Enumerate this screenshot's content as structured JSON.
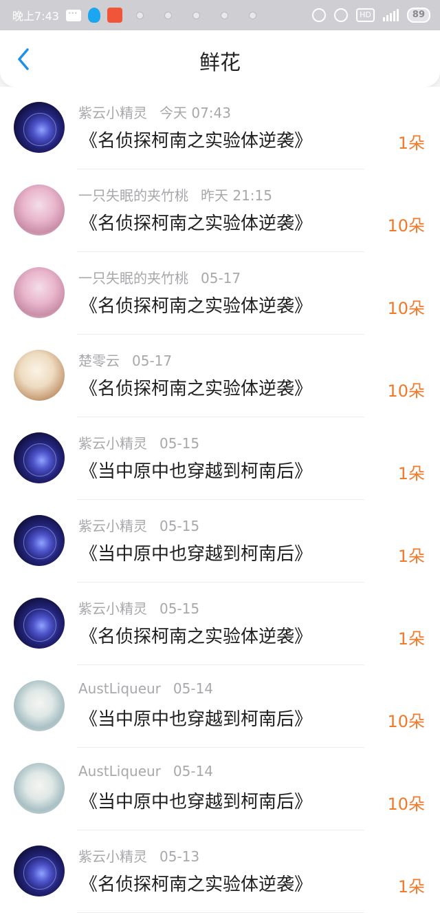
{
  "status_bar": {
    "time": "晚上7:43",
    "hd": "HD",
    "battery": "89"
  },
  "nav": {
    "title": "鲜花"
  },
  "records": [
    {
      "user": "紫云小精灵",
      "time": "今天 07:43",
      "book": "《名侦探柯南之实验体逆袭》",
      "amount": "1朵",
      "avatar": "space"
    },
    {
      "user": "一只失眠的夹竹桃",
      "time": "昨天 21:15",
      "book": "《名侦探柯南之实验体逆袭》",
      "amount": "10朵",
      "avatar": "pink"
    },
    {
      "user": "一只失眠的夹竹桃",
      "time": "05-17",
      "book": "《名侦探柯南之实验体逆袭》",
      "amount": "10朵",
      "avatar": "pink"
    },
    {
      "user": "楚零云",
      "time": "05-17",
      "book": "《名侦探柯南之实验体逆袭》",
      "amount": "10朵",
      "avatar": "blonde"
    },
    {
      "user": "紫云小精灵",
      "time": "05-15",
      "book": "《当中原中也穿越到柯南后》",
      "amount": "1朵",
      "avatar": "space"
    },
    {
      "user": "紫云小精灵",
      "time": "05-15",
      "book": "《当中原中也穿越到柯南后》",
      "amount": "1朵",
      "avatar": "space"
    },
    {
      "user": "紫云小精灵",
      "time": "05-15",
      "book": "《名侦探柯南之实验体逆袭》",
      "amount": "1朵",
      "avatar": "space"
    },
    {
      "user": "AustLiqueur",
      "time": "05-14",
      "book": "《当中原中也穿越到柯南后》",
      "amount": "10朵",
      "avatar": "teal"
    },
    {
      "user": "AustLiqueur",
      "time": "05-14",
      "book": "《当中原中也穿越到柯南后》",
      "amount": "10朵",
      "avatar": "teal"
    },
    {
      "user": "紫云小精灵",
      "time": "05-13",
      "book": "《名侦探柯南之实验体逆袭》",
      "amount": "1朵",
      "avatar": "space"
    }
  ],
  "colors": {
    "accent_blue": "#1e90e8",
    "amount_orange": "#f07a2a",
    "meta_gray": "#a8a8ac"
  }
}
